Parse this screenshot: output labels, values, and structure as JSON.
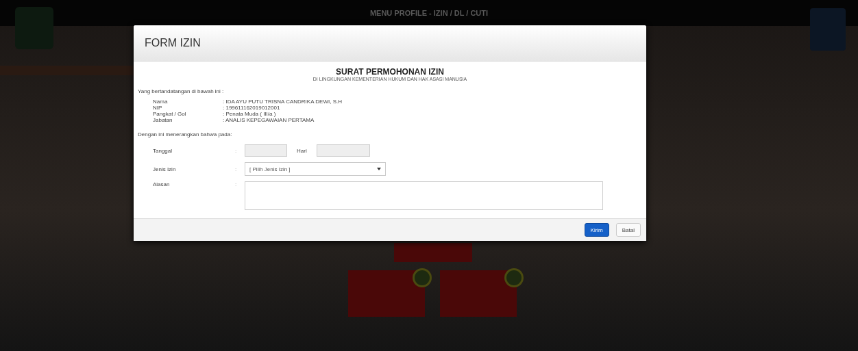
{
  "page_header": {
    "title": "MENU PROFILE - IZIN / DL / CUTI"
  },
  "dialog": {
    "title": "FORM IZIN",
    "heading": "SURAT PERMOHONAN IZIN",
    "subheading": "DI LINGKUNGAN KEMENTERIAN HUKUM DAN HAK ASASI MANUSIA",
    "intro": "Yang bertandatangan di bawah ini :",
    "details": [
      {
        "label": "Nama",
        "value": ": IDA AYU PUTU TRISNA CANDRIKA DEWI, S.H"
      },
      {
        "label": "NIP",
        "value": ": 199611162019012001"
      },
      {
        "label": "Pangkat / Gol",
        "value": ": Penata Muda ( III/a )"
      },
      {
        "label": "Jabatan",
        "value": ": ANALIS KEPEGAWAIAN PERTAMA"
      }
    ],
    "colons": [
      ":",
      ":",
      ":"
    ],
    "statement": "Dengan ini menerangkan bahwa pada:",
    "tanggal_label": "Tanggal",
    "hari_label": "Hari",
    "jenis_label": "Jenis Izin",
    "jenis_value": "[ Pilih Jenis Izin ]",
    "alasan_label": "Alasan",
    "buttons": [
      {
        "label": "Kirim",
        "kind": "primary"
      },
      {
        "label": "Batal",
        "kind": "default"
      }
    ]
  }
}
